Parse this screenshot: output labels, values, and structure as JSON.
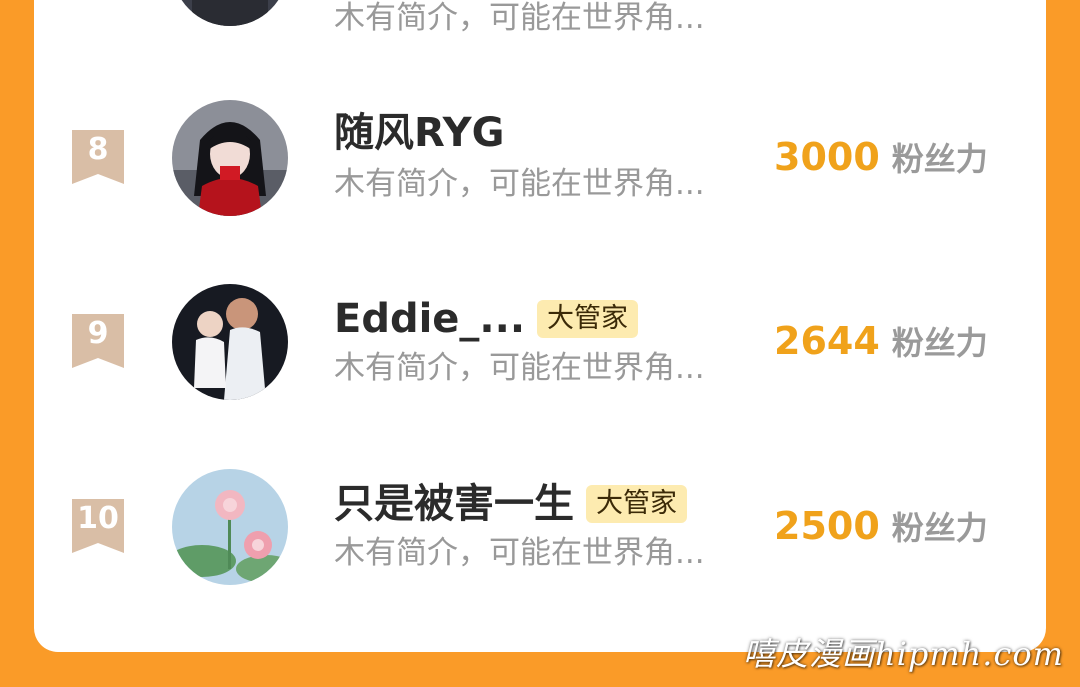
{
  "stat_unit": "粉丝力",
  "partial_row": {
    "intro": "木有简介，可能在世界角..."
  },
  "rows": [
    {
      "rank": "8",
      "name": "随风RYG",
      "badge": "",
      "intro": "木有简介，可能在世界角...",
      "value": "3000"
    },
    {
      "rank": "9",
      "name": "Eddie_...",
      "badge": "大管家",
      "intro": "木有简介，可能在世界角...",
      "value": "2644"
    },
    {
      "rank": "10",
      "name": "只是被害一生",
      "badge": "大管家",
      "intro": "木有简介，可能在世界角...",
      "value": "2500"
    }
  ],
  "watermark": "嘻皮漫画hipmh.com",
  "colors": {
    "background": "#fa9b28",
    "value": "#f0a21b",
    "badge": "#fdebb0",
    "rank_ribbon": "#d9bea6"
  }
}
